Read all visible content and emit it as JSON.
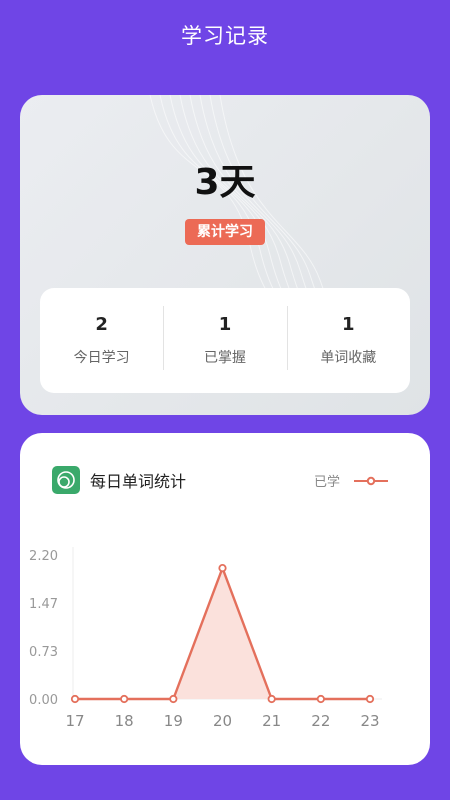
{
  "header": {
    "title": "学习记录"
  },
  "summary": {
    "days": "3天",
    "badge": "累计学习",
    "stats": [
      {
        "value": "2",
        "label": "今日学习"
      },
      {
        "value": "1",
        "label": "已掌握"
      },
      {
        "value": "1",
        "label": "单词收藏"
      }
    ]
  },
  "chart_panel": {
    "title": "每日单词统计",
    "legend_label": "已学",
    "icon": "word-stats-icon"
  },
  "chart_data": {
    "type": "area",
    "categories": [
      "17",
      "18",
      "19",
      "20",
      "21",
      "22",
      "23"
    ],
    "series": [
      {
        "name": "已学",
        "values": [
          0,
          0,
          0,
          2,
          0,
          0,
          0
        ],
        "color": "#e4705c",
        "fill": "#fbe1dc"
      }
    ],
    "y_ticks": [
      "0.00",
      "0.73",
      "1.47",
      "2.20"
    ],
    "ylim": [
      0,
      2.2
    ],
    "grid": false,
    "legend_position": "top-right"
  },
  "colors": {
    "background": "#6f45e6",
    "accent": "#ec6a55",
    "icon": "#3aa96b"
  }
}
